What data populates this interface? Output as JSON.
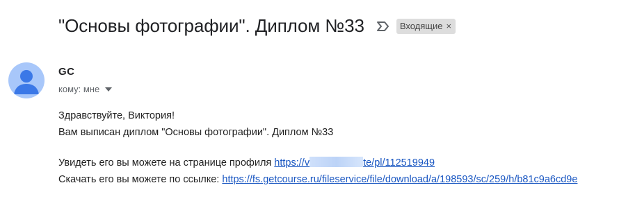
{
  "subject": "\"Основы фотографии\". Диплом №33",
  "labels": [
    {
      "text": "Входящие",
      "close": "×"
    }
  ],
  "icons": {
    "important": "importance-marker-icon",
    "avatar": "default-avatar-icon",
    "recipient_caret": "caret-down-icon"
  },
  "sender": {
    "name": "GC",
    "recipient_text": "кому: мне"
  },
  "body": {
    "greeting": "Здравствуйте, Виктория!",
    "line1": "Вам выписан диплом \"Основы фотографии\". Диплом №33",
    "view_text": "Увидеть его вы можете на странице профиля ",
    "view_link_start": "https://v",
    "view_link_end": "te/pl/112519949",
    "download_text": "Скачать его вы можете по ссылке: ",
    "download_link": "https://fs.getcourse.ru/fileservice/file/download/a/198593/sc/259/h/b81c9a6cd9e"
  },
  "colors": {
    "link": "#1a57c2",
    "avatar_bg": "#a8c7fa",
    "avatar_fg": "#3b78e7",
    "chip_bg": "#dddddd"
  }
}
